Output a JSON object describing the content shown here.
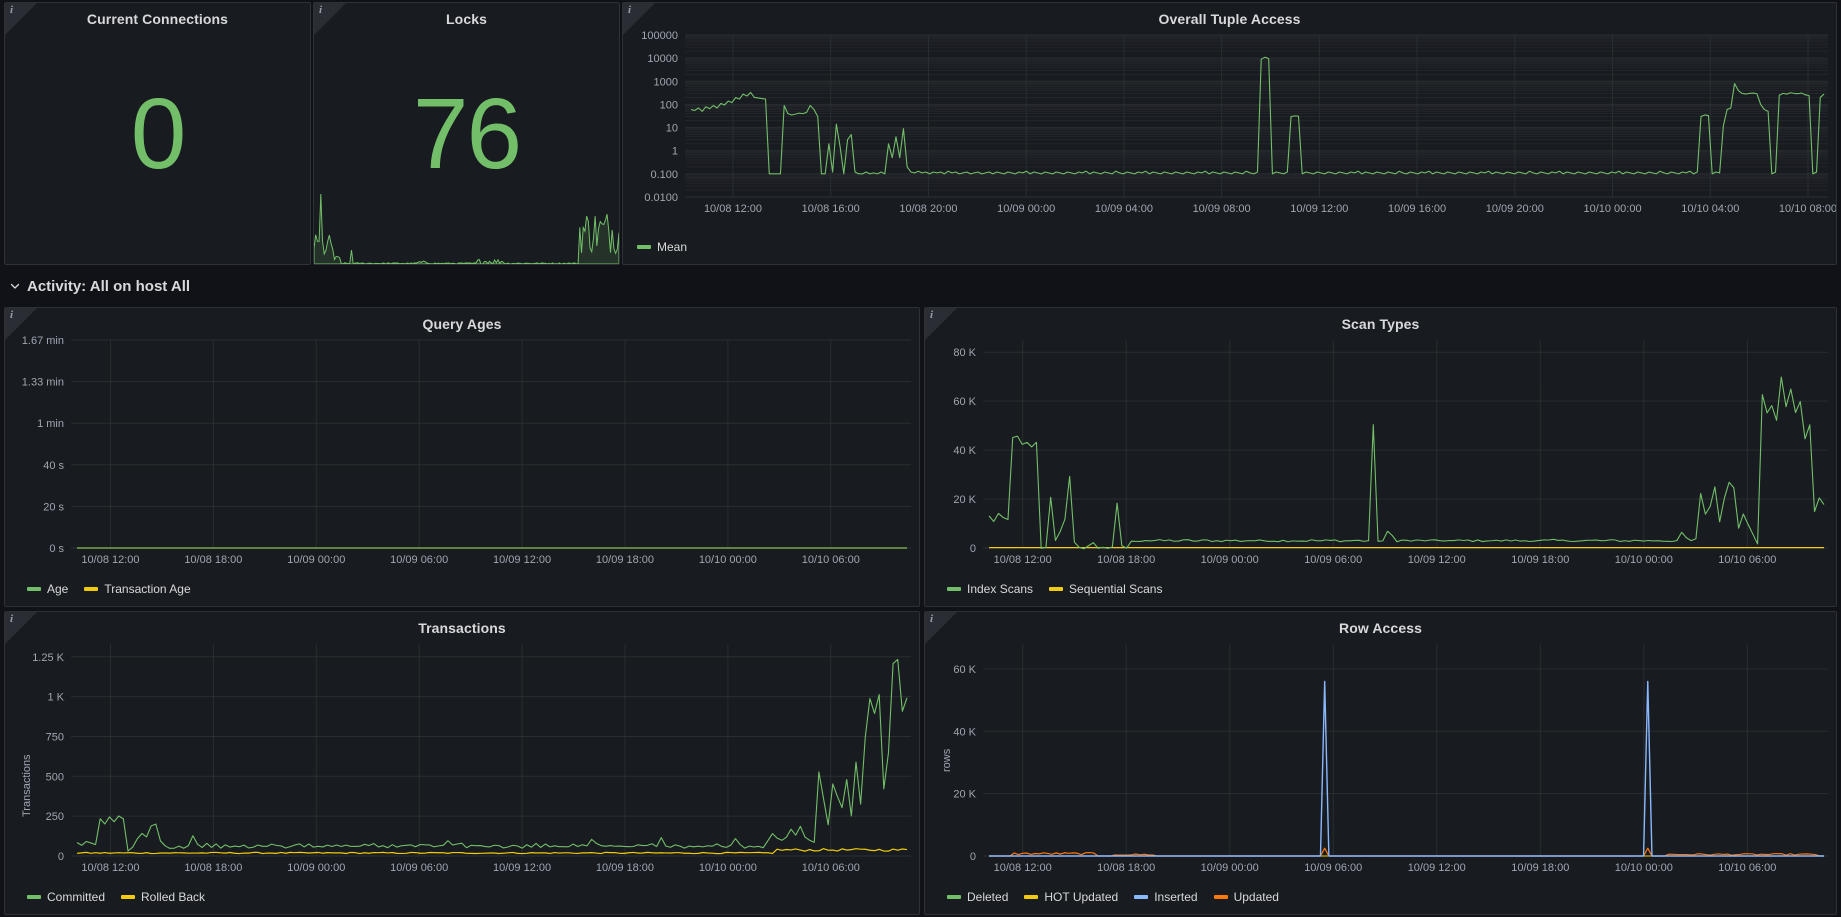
{
  "theme": {
    "bg": "#111217",
    "panel_bg": "#181b1f",
    "panel_border": "#2c3235",
    "text": "#d8d9da",
    "axis_text": "#9fa7b3",
    "grid": "#2c3235",
    "green": "#73bf69",
    "yellow": "#f2cc0c",
    "blue": "#8ab8ff",
    "orange": "#ff780a"
  },
  "icons": {
    "info": "info-icon",
    "chevron": "chevron-down-icon"
  },
  "panels": {
    "current_connections": {
      "title": "Current Connections",
      "value": "0",
      "value_color": "#73bf69"
    },
    "locks": {
      "title": "Locks",
      "value": "76",
      "value_color": "#73bf69"
    },
    "overall_tuple_access": {
      "title": "Overall Tuple Access"
    },
    "query_ages": {
      "title": "Query Ages"
    },
    "scan_types": {
      "title": "Scan Types"
    },
    "transactions": {
      "title": "Transactions"
    },
    "row_access": {
      "title": "Row Access"
    }
  },
  "row": {
    "title": "Activity: All on host All",
    "collapsed": false
  },
  "chart_data": [
    {
      "id": "overall_tuple_access",
      "type": "line",
      "title": "Overall Tuple Access",
      "xlabel": "",
      "ylabel": "",
      "yscale": "log",
      "ylim": [
        0.01,
        100000
      ],
      "yticks": [
        "0.0100",
        "0.100",
        "1",
        "10",
        "100",
        "1000",
        "10000",
        "100000"
      ],
      "ytick_values": [
        0.01,
        0.1,
        1,
        10,
        100,
        1000,
        10000,
        100000
      ],
      "xticks": [
        "10/08 12:00",
        "10/08 16:00",
        "10/08 20:00",
        "10/09 00:00",
        "10/09 04:00",
        "10/09 08:00",
        "10/09 12:00",
        "10/09 16:00",
        "10/09 20:00",
        "10/10 00:00",
        "10/10 04:00",
        "10/10 08:00"
      ],
      "grid": true,
      "legend_position": "bottom-left",
      "series": [
        {
          "name": "Mean",
          "color": "#73bf69"
        }
      ],
      "points": [
        60,
        55,
        70,
        50,
        80,
        65,
        90,
        70,
        110,
        95,
        140,
        120,
        200,
        170,
        280,
        230,
        330,
        200,
        190,
        180,
        170,
        0.1,
        0.1,
        0.1,
        0.1,
        90,
        40,
        35,
        38,
        42,
        40,
        45,
        90,
        60,
        30,
        0.1,
        0.1,
        2,
        0.12,
        14,
        1.5,
        0.1,
        3,
        5,
        0.12,
        0.1,
        0.1,
        0.12,
        0.1,
        0.11,
        0.1,
        0.12,
        0.1,
        2,
        0.5,
        4,
        0.5,
        9,
        0.2,
        0.12,
        0.11,
        0.13,
        0.11,
        0.12,
        0.1,
        0.12,
        0.11,
        0.12,
        0.1,
        0.13,
        0.11,
        0.12,
        0.1,
        0.11,
        0.12,
        0.1,
        0.11,
        0.12,
        0.1,
        0.11,
        0.12,
        0.1,
        0.12,
        0.11,
        0.1,
        0.12,
        0.11,
        0.1,
        0.12,
        0.11,
        0.13,
        0.1,
        0.12,
        0.11,
        0.1,
        0.12,
        0.11,
        0.1,
        0.12,
        0.11,
        0.1,
        0.12,
        0.11,
        0.1,
        0.12,
        0.11,
        0.13,
        0.1,
        0.12,
        0.11,
        0.1,
        0.12,
        0.11,
        0.1,
        0.13,
        0.11,
        0.1,
        0.12,
        0.11,
        0.1,
        0.12,
        0.11,
        0.13,
        0.1,
        0.12,
        0.11,
        0.1,
        0.12,
        0.11,
        0.1,
        0.12,
        0.11,
        0.1,
        0.12,
        0.11,
        0.1,
        0.12,
        0.11,
        0.13,
        0.1,
        0.12,
        0.11,
        0.1,
        0.12,
        0.11,
        0.1,
        0.12,
        0.11,
        0.1,
        0.13,
        0.11,
        0.1,
        0.12,
        9000,
        11000,
        9500,
        0.1,
        0.12,
        0.11,
        0.1,
        0.12,
        30,
        32,
        31,
        0.1,
        0.12,
        0.11,
        0.1,
        0.12,
        0.11,
        0.1,
        0.12,
        0.11,
        0.1,
        0.12,
        0.11,
        0.1,
        0.12,
        0.11,
        0.13,
        0.1,
        0.12,
        0.11,
        0.1,
        0.12,
        0.11,
        0.1,
        0.12,
        0.11,
        0.1,
        0.13,
        0.11,
        0.1,
        0.12,
        0.11,
        0.1,
        0.12,
        0.11,
        0.13,
        0.1,
        0.12,
        0.11,
        0.1,
        0.12,
        0.11,
        0.1,
        0.12,
        0.11,
        0.1,
        0.12,
        0.11,
        0.1,
        0.12,
        0.11,
        0.13,
        0.1,
        0.12,
        0.11,
        0.1,
        0.12,
        0.11,
        0.1,
        0.12,
        0.11,
        0.1,
        0.13,
        0.11,
        0.1,
        0.12,
        0.11,
        0.1,
        0.12,
        0.11,
        0.13,
        0.1,
        0.12,
        0.11,
        0.1,
        0.12,
        0.11,
        0.1,
        0.12,
        0.11,
        0.1,
        0.12,
        0.11,
        0.1,
        0.12,
        0.11,
        0.13,
        0.1,
        0.12,
        0.11,
        0.1,
        0.12,
        0.11,
        0.1,
        0.12,
        0.11,
        0.1,
        0.13,
        0.11,
        0.1,
        0.12,
        0.11,
        0.1,
        0.12,
        0.11,
        0.13,
        0.1,
        0.12,
        30,
        35,
        33,
        0.1,
        0.12,
        0.11,
        12,
        60,
        70,
        800,
        400,
        300,
        280,
        300,
        310,
        290,
        100,
        60,
        50,
        0.1,
        0.12,
        250,
        300,
        280,
        320,
        300,
        290,
        310,
        260,
        240,
        0.1,
        0.12,
        200,
        280
      ]
    },
    {
      "id": "query_ages",
      "type": "line",
      "title": "Query Ages",
      "xlabel": "",
      "ylabel": "",
      "ylim": [
        0,
        100
      ],
      "yticks": [
        "0 s",
        "20 s",
        "40 s",
        "1 min",
        "1.33 min",
        "1.67 min"
      ],
      "ytick_values": [
        0,
        20,
        40,
        60,
        80,
        100
      ],
      "xticks": [
        "10/08 12:00",
        "10/08 18:00",
        "10/09 00:00",
        "10/09 06:00",
        "10/09 12:00",
        "10/09 18:00",
        "10/10 00:00",
        "10/10 06:00"
      ],
      "grid": true,
      "legend_position": "bottom-left",
      "series": [
        {
          "name": "Age",
          "color": "#73bf69",
          "values_flat": 0
        },
        {
          "name": "Transaction Age",
          "color": "#f2cc0c",
          "values_flat": 0
        }
      ]
    },
    {
      "id": "scan_types",
      "type": "line",
      "title": "Scan Types",
      "xlabel": "",
      "ylabel": "",
      "ylim": [
        0,
        85000
      ],
      "yticks": [
        "0",
        "20 K",
        "40 K",
        "60 K",
        "80 K"
      ],
      "ytick_values": [
        0,
        20000,
        40000,
        60000,
        80000
      ],
      "xticks": [
        "10/08 12:00",
        "10/08 18:00",
        "10/09 00:00",
        "10/09 06:00",
        "10/09 12:00",
        "10/09 18:00",
        "10/10 00:00",
        "10/10 06:00"
      ],
      "grid": true,
      "legend_position": "bottom-left",
      "series": [
        {
          "name": "Index Scans",
          "color": "#73bf69"
        },
        {
          "name": "Sequential Scans",
          "color": "#f2cc0c"
        }
      ],
      "index_scans": [
        13000,
        11000,
        14000,
        12000,
        11500,
        45000,
        46000,
        42000,
        43000,
        41000,
        43000,
        0,
        0,
        21000,
        3000,
        7000,
        12000,
        29000,
        2000,
        0,
        0,
        1000,
        2000,
        0,
        500,
        0,
        0,
        18000,
        1000,
        0,
        2500,
        3000,
        3000,
        3200,
        3000,
        3100,
        3000,
        3000,
        3100,
        3000,
        2900,
        3000,
        3100,
        3000,
        2800,
        3000,
        3100,
        3000,
        2900,
        3000,
        3000,
        3100,
        3000,
        2900,
        3000,
        3100,
        3000,
        2900,
        3000,
        3100,
        3000,
        2900,
        3000,
        3000,
        3100,
        3000,
        2900,
        3000,
        3100,
        3000,
        2900,
        3000,
        3000,
        3100,
        3000,
        2900,
        3000,
        3100,
        3000,
        2900,
        3000,
        50000,
        3000,
        2900,
        6500,
        5000,
        3000,
        3100,
        3000,
        2900,
        3000,
        3000,
        3100,
        3000,
        2900,
        3000,
        3100,
        3000,
        2900,
        3000,
        3000,
        3100,
        3000,
        2900,
        3000,
        3100,
        3000,
        2900,
        3000,
        3000,
        3100,
        3000,
        2900,
        3000,
        3100,
        3000,
        2900,
        3000,
        3000,
        3100,
        3000,
        2900,
        3000,
        3100,
        3000,
        2900,
        3000,
        3000,
        3100,
        3000,
        2900,
        3000,
        3100,
        3000,
        2900,
        3000,
        3000,
        3100,
        3000,
        2900,
        3000,
        3100,
        3000,
        2900,
        3000,
        3000,
        6000,
        4000,
        3000,
        3500,
        22000,
        14000,
        17000,
        25000,
        11000,
        20000,
        27000,
        25000,
        8000,
        14000,
        10000,
        6000,
        2000,
        63000,
        55000,
        58000,
        52000,
        70000,
        58000,
        65000,
        55000,
        60000,
        45000,
        50000,
        15000,
        20000,
        18000
      ],
      "sequential_scans_flat": 150
    },
    {
      "id": "transactions",
      "type": "line",
      "title": "Transactions",
      "xlabel": "",
      "ylabel": "Transactions",
      "ylim": [
        0,
        1330
      ],
      "yticks": [
        "0",
        "250",
        "500",
        "750",
        "1 K",
        "1.25 K"
      ],
      "ytick_values": [
        0,
        250,
        500,
        750,
        1000,
        1250
      ],
      "xticks": [
        "10/08 12:00",
        "10/08 18:00",
        "10/09 00:00",
        "10/09 06:00",
        "10/09 12:00",
        "10/09 18:00",
        "10/10 00:00",
        "10/10 06:00"
      ],
      "grid": true,
      "legend_position": "bottom-left",
      "series": [
        {
          "name": "Committed",
          "color": "#73bf69"
        },
        {
          "name": "Rolled Back",
          "color": "#f2cc0c"
        }
      ],
      "committed": [
        90,
        75,
        100,
        80,
        70,
        230,
        210,
        250,
        220,
        260,
        240,
        40,
        60,
        100,
        150,
        120,
        180,
        210,
        90,
        60,
        50,
        60,
        70,
        55,
        60,
        120,
        70,
        60,
        80,
        60,
        70,
        60,
        75,
        60,
        65,
        60,
        70,
        60,
        65,
        60,
        70,
        60,
        65,
        60,
        70,
        60,
        65,
        60,
        70,
        60,
        65,
        60,
        70,
        60,
        65,
        60,
        70,
        60,
        65,
        60,
        70,
        60,
        65,
        60,
        70,
        60,
        65,
        60,
        70,
        60,
        65,
        60,
        70,
        60,
        65,
        60,
        70,
        60,
        65,
        60,
        95,
        60,
        65,
        70,
        60,
        65,
        60,
        70,
        60,
        65,
        60,
        70,
        60,
        65,
        60,
        70,
        60,
        65,
        60,
        70,
        60,
        65,
        60,
        70,
        60,
        65,
        60,
        70,
        60,
        65,
        60,
        100,
        70,
        60,
        65,
        60,
        70,
        60,
        65,
        60,
        70,
        60,
        65,
        60,
        70,
        60,
        110,
        60,
        65,
        60,
        70,
        60,
        65,
        60,
        70,
        60,
        65,
        60,
        70,
        60,
        65,
        60,
        120,
        70,
        60,
        65,
        60,
        70,
        60,
        100,
        130,
        110,
        90,
        120,
        160,
        140,
        180,
        120,
        100,
        90,
        520,
        350,
        200,
        450,
        380,
        300,
        480,
        250,
        600,
        330,
        750,
        980,
        900,
        1020,
        420,
        640,
        1200,
        1230,
        900,
        1000
      ],
      "rolled_back_flat": 15
    },
    {
      "id": "row_access",
      "type": "line",
      "title": "Row Access",
      "xlabel": "",
      "ylabel": "rows",
      "ylim": [
        0,
        68000
      ],
      "yticks": [
        "0",
        "20 K",
        "40 K",
        "60 K"
      ],
      "ytick_values": [
        0,
        20000,
        40000,
        60000
      ],
      "xticks": [
        "10/08 12:00",
        "10/08 18:00",
        "10/09 00:00",
        "10/09 06:00",
        "10/09 12:00",
        "10/09 18:00",
        "10/10 00:00",
        "10/10 06:00"
      ],
      "grid": true,
      "legend_position": "bottom-left",
      "series": [
        {
          "name": "Deleted",
          "color": "#73bf69"
        },
        {
          "name": "HOT Updated",
          "color": "#f2cc0c"
        },
        {
          "name": "Inserted",
          "color": "#8ab8ff"
        },
        {
          "name": "Updated",
          "color": "#ff780a"
        }
      ],
      "inserted_spikes": [
        {
          "index": 80,
          "value": 56000
        },
        {
          "index": 157,
          "value": 56000
        }
      ],
      "updated_spikes": [
        {
          "index": 80,
          "value": 2500
        },
        {
          "index": 157,
          "value": 2500
        }
      ]
    }
  ]
}
